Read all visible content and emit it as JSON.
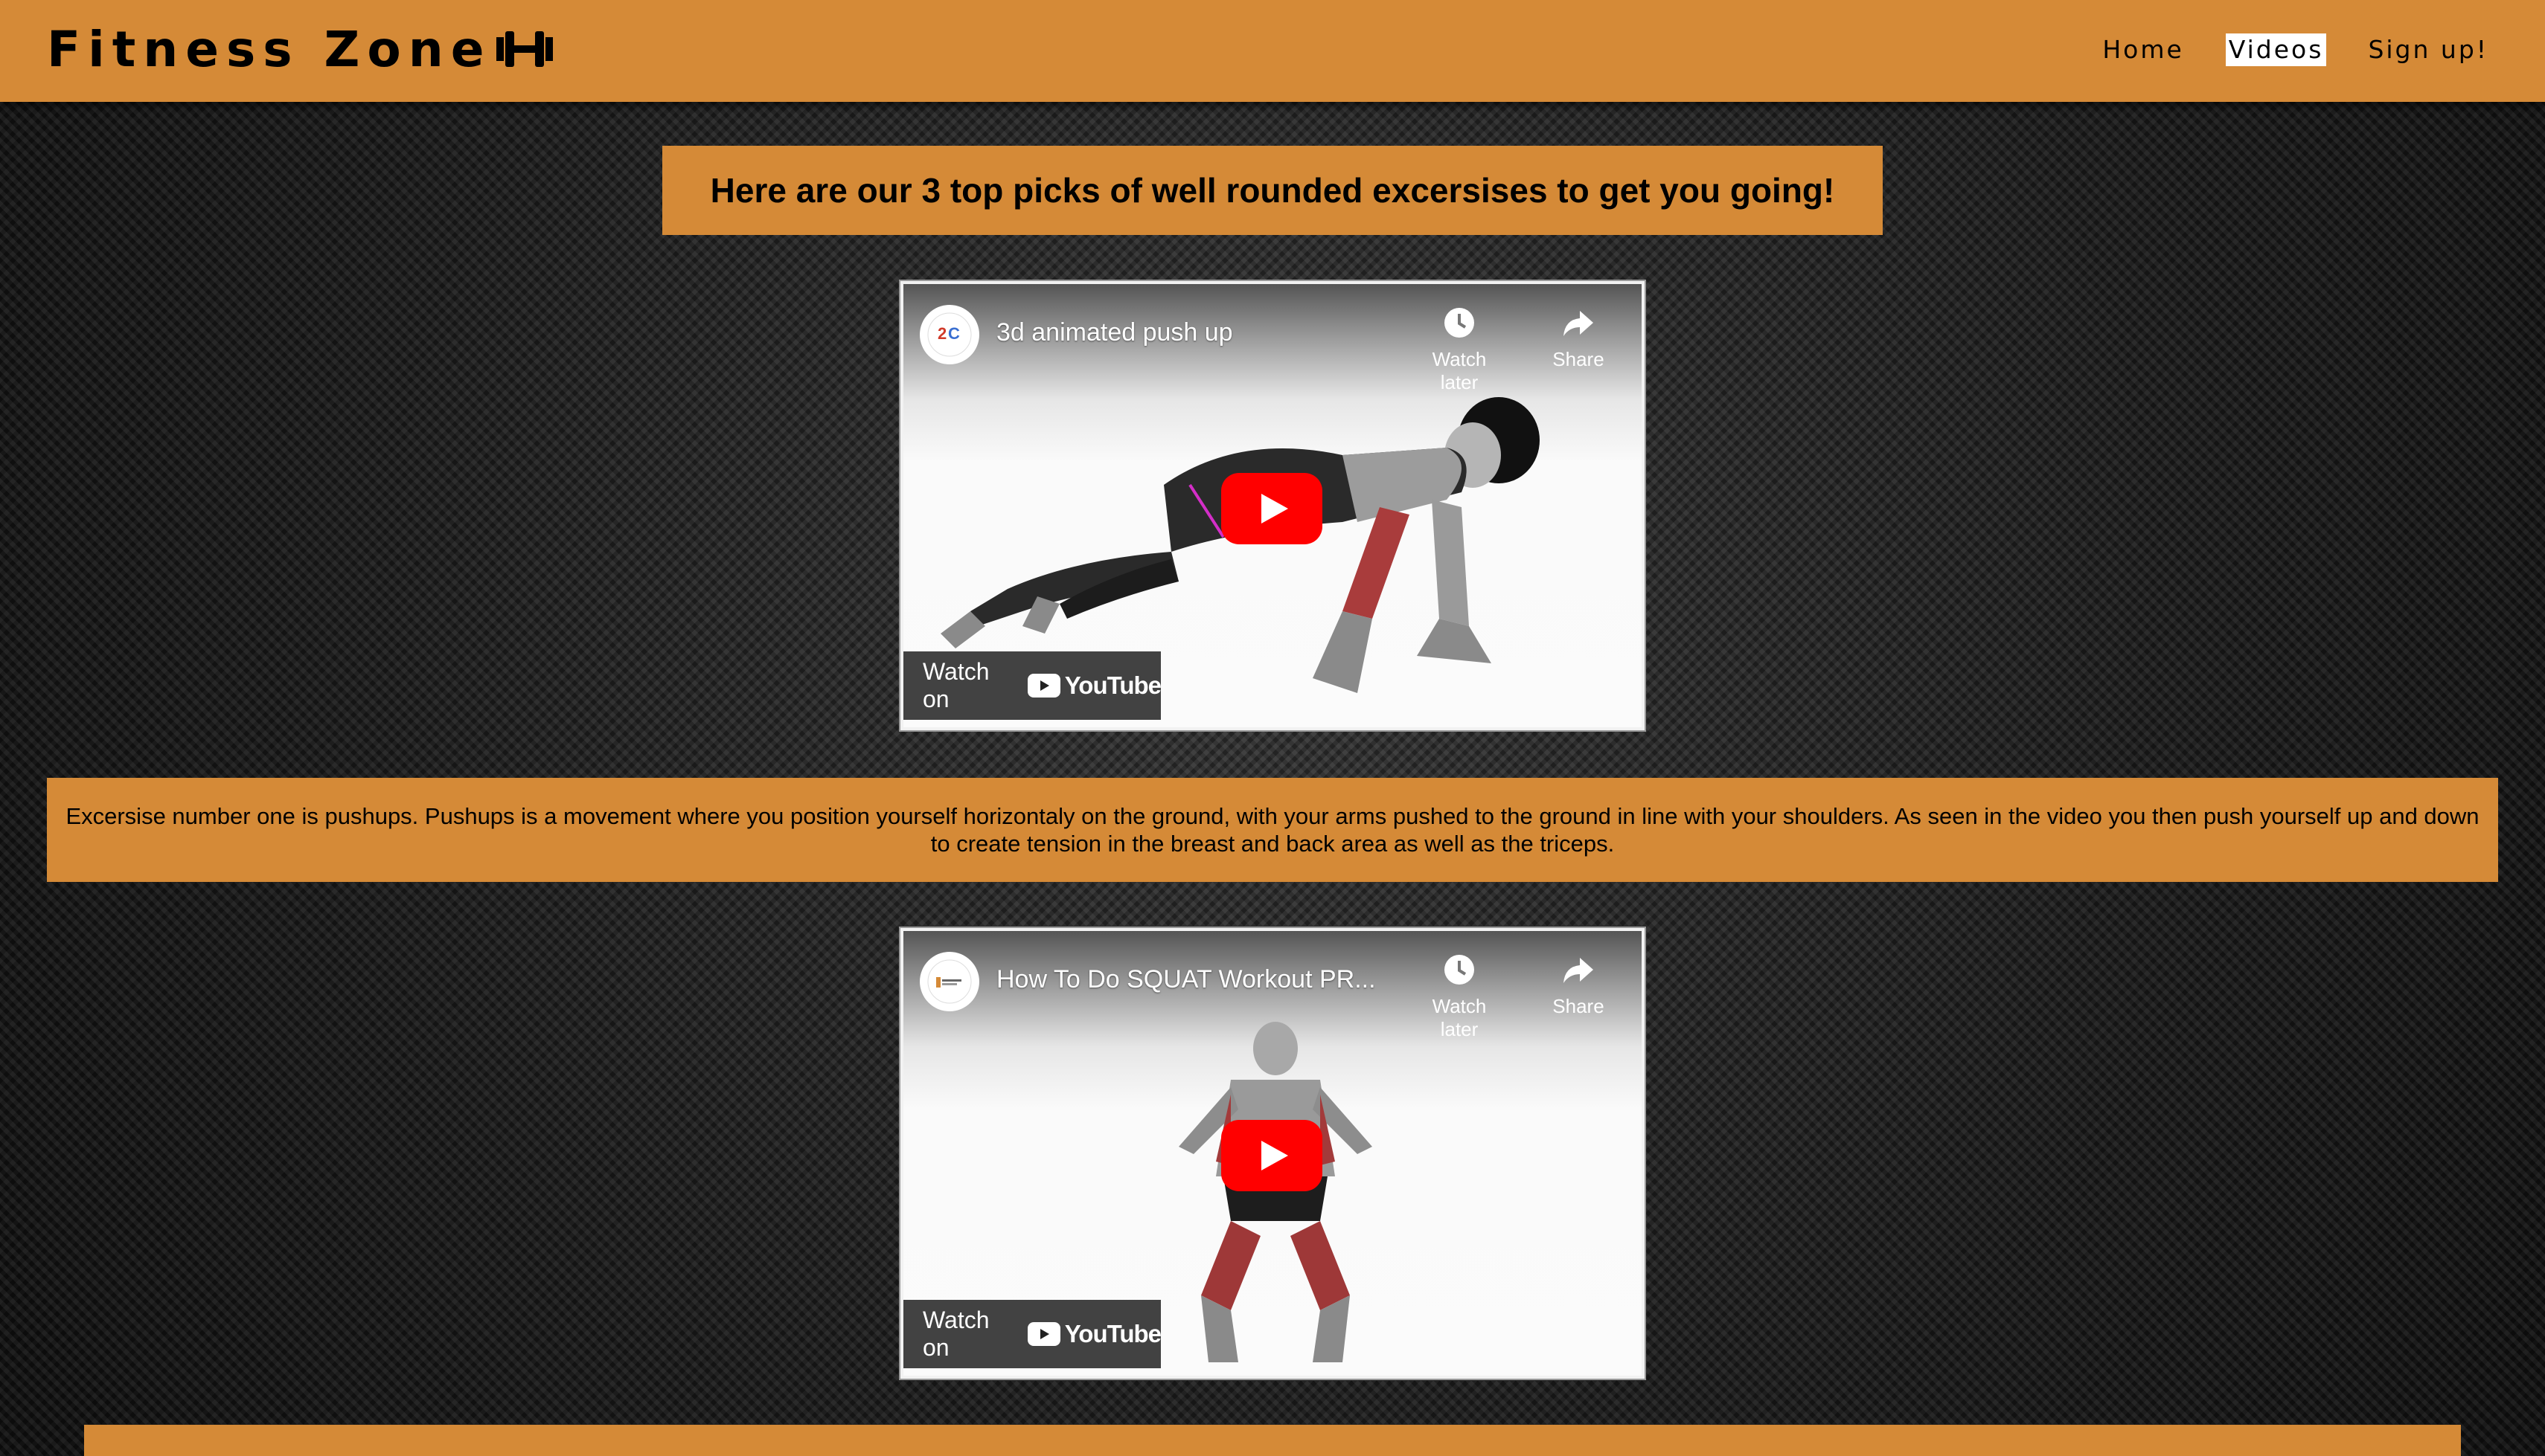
{
  "header": {
    "brand": "Fitness Zone",
    "brand_icon": "dumbbell-icon",
    "nav": [
      {
        "label": "Home",
        "active": false
      },
      {
        "label": "Videos",
        "active": true
      },
      {
        "label": "Sign up!",
        "active": false
      }
    ]
  },
  "main": {
    "headline": "Here are our 3 top picks of well rounded excersises to get you going!",
    "videos": [
      {
        "title": "3d animated push up",
        "watch_later_label": "Watch later",
        "share_label": "Share",
        "watch_on_label": "Watch on",
        "platform": "YouTube",
        "channel_icon": "channel-avatar-icon"
      },
      {
        "title": "How To Do SQUAT Workout PR...",
        "watch_later_label": "Watch later",
        "share_label": "Share",
        "watch_on_label": "Watch on",
        "platform": "YouTube",
        "channel_icon": "channel-avatar-icon"
      }
    ],
    "descriptions": [
      "Excersise number one is pushups. Pushups is a movement where you position yourself horizontaly on the ground, with your arms pushed to the ground in line with your shoulders. As seen in the video you then push yourself up and down to create tension in the breast and back area as well as the triceps."
    ]
  },
  "colors": {
    "accent": "#d58a37",
    "play_red": "#ff0000",
    "active_nav_bg": "#ffffff"
  }
}
